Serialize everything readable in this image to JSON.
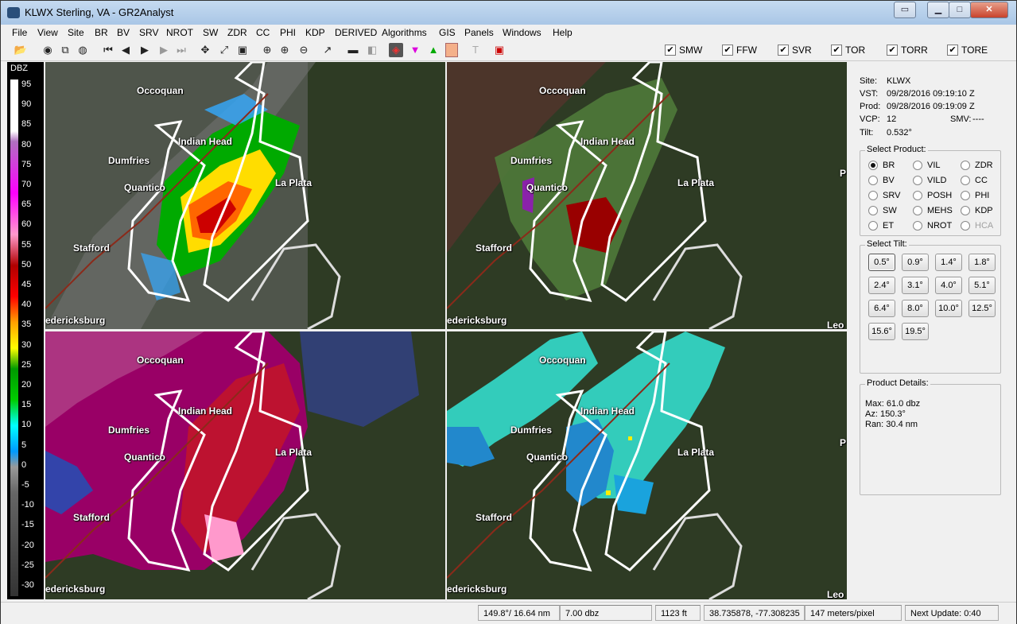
{
  "window": {
    "title": "KLWX Sterling, VA - GR2Analyst"
  },
  "menu": [
    "File",
    "View",
    "Site",
    "BR",
    "BV",
    "SRV",
    "NROT",
    "SW",
    "ZDR",
    "CC",
    "PHI",
    "KDP",
    "DERIVED",
    "Algorithms",
    "GIS",
    "Panels",
    "Windows",
    "Help"
  ],
  "warnings": [
    {
      "label": "SMW",
      "checked": true
    },
    {
      "label": "FFW",
      "checked": true
    },
    {
      "label": "SVR",
      "checked": true
    },
    {
      "label": "TOR",
      "checked": true
    },
    {
      "label": "TORR",
      "checked": true
    },
    {
      "label": "TORE",
      "checked": true
    }
  ],
  "color_scale": {
    "unit": "DBZ",
    "ticks": [
      "95",
      "90",
      "85",
      "80",
      "75",
      "70",
      "65",
      "60",
      "55",
      "50",
      "45",
      "40",
      "35",
      "30",
      "25",
      "20",
      "15",
      "10",
      "5",
      "0",
      "-5",
      "-10",
      "-15",
      "-20",
      "-25",
      "-30"
    ]
  },
  "map": {
    "cities": [
      "Occoquan",
      "Indian Head",
      "Dumfries",
      "Quantico",
      "La Plata",
      "Stafford",
      "edericksburg",
      "Leo",
      "P"
    ]
  },
  "info": {
    "site_label": "Site:",
    "site": "KLWX",
    "vst_label": "VST:",
    "vst": "09/28/2016  09:19:10 Z",
    "prod_label": "Prod:",
    "prod": "09/28/2016  09:19:09 Z",
    "vcp_label": "VCP:",
    "vcp": "12",
    "smv_label": "SMV:",
    "smv": "----",
    "tilt_label": "Tilt:",
    "tilt": "0.532°"
  },
  "select_product": {
    "title": "Select Product:",
    "items": [
      {
        "label": "BR",
        "selected": true,
        "disabled": false
      },
      {
        "label": "VIL",
        "selected": false,
        "disabled": false
      },
      {
        "label": "ZDR",
        "selected": false,
        "disabled": false
      },
      {
        "label": "BV",
        "selected": false,
        "disabled": false
      },
      {
        "label": "VILD",
        "selected": false,
        "disabled": false
      },
      {
        "label": "CC",
        "selected": false,
        "disabled": false
      },
      {
        "label": "SRV",
        "selected": false,
        "disabled": false
      },
      {
        "label": "POSH",
        "selected": false,
        "disabled": false
      },
      {
        "label": "PHI",
        "selected": false,
        "disabled": false
      },
      {
        "label": "SW",
        "selected": false,
        "disabled": false
      },
      {
        "label": "MEHS",
        "selected": false,
        "disabled": false
      },
      {
        "label": "KDP",
        "selected": false,
        "disabled": false
      },
      {
        "label": "ET",
        "selected": false,
        "disabled": false
      },
      {
        "label": "NROT",
        "selected": false,
        "disabled": false
      },
      {
        "label": "HCA",
        "selected": false,
        "disabled": true
      }
    ]
  },
  "select_tilt": {
    "title": "Select Tilt:",
    "items": [
      "0.5°",
      "0.9°",
      "1.4°",
      "1.8°",
      "2.4°",
      "3.1°",
      "4.0°",
      "5.1°",
      "6.4°",
      "8.0°",
      "10.0°",
      "12.5°",
      "15.6°",
      "19.5°"
    ],
    "selected": "0.5°"
  },
  "details": {
    "title": "Product Details:",
    "max": "Max:  61.0 dbz",
    "az": "Az:  150.3°",
    "ran": "Ran:  30.4 nm"
  },
  "status": {
    "az_range": "149.8°/ 16.64 nm",
    "value": "7.00 dbz",
    "height": "1123 ft",
    "coords": "38.735878, -77.308235",
    "resolution": "147 meters/pixel",
    "next_update": "Next Update: 0:40"
  }
}
